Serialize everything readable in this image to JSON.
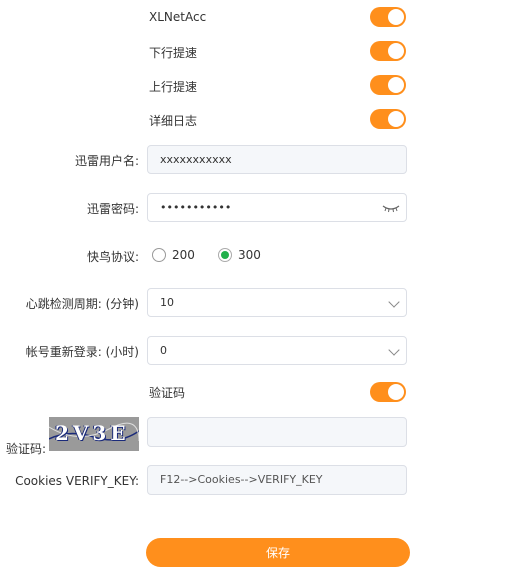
{
  "toggles": [
    {
      "label": "XLNetAcc",
      "on": true
    },
    {
      "label": "下行提速",
      "on": true
    },
    {
      "label": "上行提速",
      "on": true
    },
    {
      "label": "详细日志",
      "on": true
    }
  ],
  "username": {
    "label": "迅雷用户名:",
    "value": "xxxxxxxxxxx"
  },
  "password": {
    "label": "迅雷密码:",
    "value": "•••••••••••"
  },
  "protocol": {
    "label": "快鸟协议:",
    "options": [
      "200",
      "300"
    ],
    "selected": "300"
  },
  "heartbeat": {
    "label": "心跳检测周期: (分钟)",
    "value": "10"
  },
  "relogin": {
    "label": "帐号重新登录: (小时)",
    "value": "0"
  },
  "captcha_toggle": {
    "label": "验证码",
    "on": true
  },
  "captcha": {
    "label": "验证码:",
    "image_text": "2V3E",
    "value": ""
  },
  "cookies": {
    "label": "Cookies VERIFY_KEY:",
    "placeholder": "F12-->Cookies-->VERIFY_KEY"
  },
  "save_label": "保存",
  "colors": {
    "accent": "#ff8f1c",
    "radio_selected": "#21b04b"
  }
}
